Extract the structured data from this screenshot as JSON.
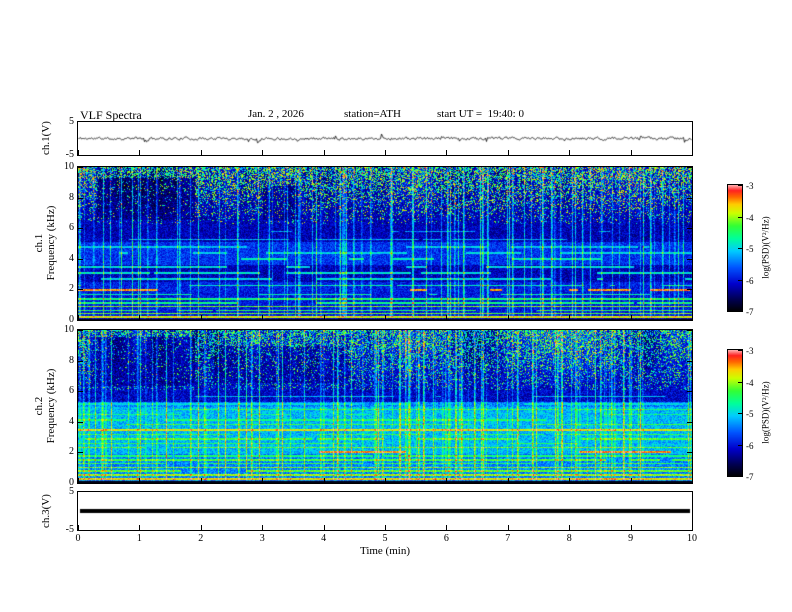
{
  "header": {
    "title": "VLF Spectra",
    "date": "Jan. 2 , 2026",
    "station": "station=ATH",
    "start_ut": "start UT =  19:40: 0"
  },
  "xaxis": {
    "label": "Time (min)",
    "min": 0,
    "max": 10,
    "ticks": [
      0,
      1,
      2,
      3,
      4,
      5,
      6,
      7,
      8,
      9,
      10
    ]
  },
  "colorbar": {
    "label": "log(PSD)(V²/Hz)",
    "min": -7,
    "max": -3,
    "ticks": [
      -3,
      -4,
      -5,
      -6,
      -7
    ]
  },
  "colormap": [
    {
      "t": 0.0,
      "c": "#000000"
    },
    {
      "t": 0.1,
      "c": "#000055"
    },
    {
      "t": 0.22,
      "c": "#0000cc"
    },
    {
      "t": 0.35,
      "c": "#0055ff"
    },
    {
      "t": 0.48,
      "c": "#00ccff"
    },
    {
      "t": 0.58,
      "c": "#00ff99"
    },
    {
      "t": 0.68,
      "c": "#33ff33"
    },
    {
      "t": 0.78,
      "c": "#ccff00"
    },
    {
      "t": 0.85,
      "c": "#ffcc00"
    },
    {
      "t": 0.91,
      "c": "#ff6600"
    },
    {
      "t": 0.96,
      "c": "#ff2222"
    },
    {
      "t": 1.0,
      "c": "#ffaaaa"
    }
  ],
  "chart_data": [
    {
      "type": "line",
      "name": "ch1_waveform",
      "ylabel": "ch.1(V)",
      "ylim": [
        -5,
        5
      ],
      "yticks": [
        5,
        -5
      ],
      "xlim_min": [
        0,
        10
      ],
      "line_color": "#000000",
      "seed": 11,
      "noise_amp_V": 0.7,
      "spike_prob": 0.018,
      "spike_amp_V": 1.8,
      "description": "Broadband VLF time series oscillating about 0 V, mostly within ±1 V with sporadic impulsive spikes to about ±2 V"
    },
    {
      "type": "heatmap",
      "name": "ch1_spectrogram",
      "ylabel_lines": [
        "ch.1",
        "Frequency (kHz)"
      ],
      "ylim": [
        0,
        10
      ],
      "yticks": [
        10,
        8,
        6,
        4,
        2,
        0
      ],
      "xlim": [
        0,
        10
      ],
      "zlabel": "log(PSD)(V²/Hz)",
      "zlim": [
        -7,
        -3
      ],
      "seed": 21,
      "base": 0.2,
      "jitter": 0.16,
      "black_below": 0.13,
      "regions": [
        {
          "f0": 3.6,
          "f1": 5.15,
          "base": 0.3
        },
        {
          "f0": 1.9,
          "f1": 2.5,
          "base": 0.27
        },
        {
          "f0": 0.15,
          "f1": 1.9,
          "base": 0.26
        }
      ],
      "speckle": {
        "f0": 6.3,
        "d0": 0.05,
        "d1": 0.55,
        "amp": 0.45
      },
      "dark_patches": [
        {
          "t0": 0.3,
          "t1": 1.9,
          "f0": 6.6,
          "f1": 9.3,
          "mult": 0.25
        },
        {
          "t0": 3.0,
          "t1": 3.6,
          "f0": 6.6,
          "f1": 8.8,
          "mult": 0.4
        }
      ],
      "streaks": {
        "count": 90,
        "strength": 0.35,
        "fmin": 0.2
      },
      "bands": [
        {
          "f": 0.25,
          "hw": 0.06,
          "v": 0.8,
          "duty": 1
        },
        {
          "f": 0.45,
          "hw": 0.05,
          "v": 0.7,
          "duty": 1
        },
        {
          "f": 0.65,
          "hw": 0.05,
          "v": 0.64,
          "duty": 0.9
        },
        {
          "f": 0.9,
          "hw": 0.05,
          "v": 0.72,
          "duty": 1
        },
        {
          "f": 1.15,
          "hw": 0.05,
          "v": 0.6,
          "duty": 0.85
        },
        {
          "f": 1.4,
          "hw": 0.05,
          "v": 0.62,
          "duty": 0.9
        },
        {
          "f": 1.7,
          "hw": 0.05,
          "v": 0.55,
          "duty": 0.7
        },
        {
          "f": 2.0,
          "hw": 0.07,
          "v": 0.88,
          "duty": 0.35
        },
        {
          "f": 2.3,
          "hw": 0.05,
          "v": 0.55,
          "duty": 0.6
        },
        {
          "f": 2.7,
          "hw": 0.05,
          "v": 0.5,
          "duty": 0.6
        },
        {
          "f": 3.1,
          "hw": 0.05,
          "v": 0.52,
          "duty": 0.5
        },
        {
          "f": 3.5,
          "hw": 0.05,
          "v": 0.5,
          "duty": 0.55
        },
        {
          "f": 4.0,
          "hw": 0.06,
          "v": 0.55,
          "duty": 0.5
        },
        {
          "f": 4.4,
          "hw": 0.05,
          "v": 0.5,
          "duty": 0.5
        },
        {
          "f": 4.8,
          "hw": 0.05,
          "v": 0.48,
          "duty": 0.5
        },
        {
          "f": 5.3,
          "hw": 0.04,
          "v": 0.45,
          "duty": 0.4
        },
        {
          "f": 5.8,
          "hw": 0.04,
          "v": 0.42,
          "duty": 0.3
        }
      ],
      "description": "ch.1 spectrogram: dark-blue background, dense green/yellow impulsive speckle above ~6.5 kHz, vertical sferic streaks, narrowband horizontal lines below ~5 kHz, intermittent red segments near 2 kHz, black strip at 0 kHz"
    },
    {
      "type": "heatmap",
      "name": "ch2_spectrogram",
      "ylabel_lines": [
        "ch.2",
        "Frequency (kHz)"
      ],
      "ylim": [
        0,
        10
      ],
      "yticks": [
        10,
        8,
        6,
        4,
        2,
        0
      ],
      "xlim": [
        0,
        10
      ],
      "zlabel": "log(PSD)(V²/Hz)",
      "zlim": [
        -7,
        -3
      ],
      "seed": 22,
      "base": 0.22,
      "jitter": 0.18,
      "black_below": 0.15,
      "regions": [
        {
          "f0": 0.15,
          "f1": 5.3,
          "base": 0.4
        },
        {
          "f0": 1.9,
          "f1": 5.0,
          "base": 0.46
        }
      ],
      "speckle": {
        "f0": 6.1,
        "d0": 0.1,
        "d1": 0.48,
        "amp": 0.35
      },
      "dark_patches": [
        {
          "t0": 0.2,
          "t1": 1.9,
          "f0": 6.4,
          "f1": 9.6,
          "mult": 0.2
        },
        {
          "t0": 2.2,
          "t1": 4.4,
          "f0": 6.6,
          "f1": 9.0,
          "mult": 0.45
        }
      ],
      "streaks": {
        "count": 110,
        "strength": 0.35,
        "fmin": 0.2
      },
      "bands": [
        {
          "f": 0.3,
          "hw": 0.07,
          "v": 0.82,
          "duty": 1
        },
        {
          "f": 0.55,
          "hw": 0.05,
          "v": 0.75,
          "duty": 1
        },
        {
          "f": 0.8,
          "hw": 0.05,
          "v": 0.7,
          "duty": 0.9
        },
        {
          "f": 1.05,
          "hw": 0.05,
          "v": 0.72,
          "duty": 1
        },
        {
          "f": 1.3,
          "hw": 0.05,
          "v": 0.65,
          "duty": 0.9
        },
        {
          "f": 1.55,
          "hw": 0.05,
          "v": 0.68,
          "duty": 0.9
        },
        {
          "f": 1.8,
          "hw": 0.05,
          "v": 0.62,
          "duty": 0.8
        },
        {
          "f": 2.05,
          "hw": 0.08,
          "v": 0.88,
          "duty": 0.45
        },
        {
          "f": 2.35,
          "hw": 0.05,
          "v": 0.7,
          "duty": 0.9
        },
        {
          "f": 2.6,
          "hw": 0.05,
          "v": 0.65,
          "duty": 0.8
        },
        {
          "f": 2.9,
          "hw": 0.05,
          "v": 0.68,
          "duty": 0.8
        },
        {
          "f": 3.2,
          "hw": 0.05,
          "v": 0.66,
          "duty": 0.8
        },
        {
          "f": 3.5,
          "hw": 0.07,
          "v": 0.8,
          "duty": 1
        },
        {
          "f": 3.85,
          "hw": 0.05,
          "v": 0.66,
          "duty": 0.8
        },
        {
          "f": 4.15,
          "hw": 0.05,
          "v": 0.62,
          "duty": 0.7
        },
        {
          "f": 4.5,
          "hw": 0.05,
          "v": 0.6,
          "duty": 0.7
        },
        {
          "f": 4.85,
          "hw": 0.05,
          "v": 0.64,
          "duty": 0.8
        },
        {
          "f": 5.2,
          "hw": 0.04,
          "v": 0.5,
          "duty": 0.5
        },
        {
          "f": 5.7,
          "hw": 0.04,
          "v": 0.45,
          "duty": 0.4
        }
      ],
      "description": "ch.2 spectrogram: brighter green/cyan background below ~5 kHz with many narrowband lines (strong yellow line near 3.5 kHz, red segments near 2 kHz), dark blue speckled region above 6 kHz with sferic streaks"
    },
    {
      "type": "line",
      "name": "ch3_flat",
      "ylabel": "ch.3(V)",
      "ylim": [
        -5,
        5
      ],
      "yticks": [
        5,
        -5
      ],
      "value_V": 0,
      "line_thickness_px": 4,
      "line_color": "#000000",
      "description": "Constant 0 V thick flat black line (channel inactive)"
    }
  ]
}
